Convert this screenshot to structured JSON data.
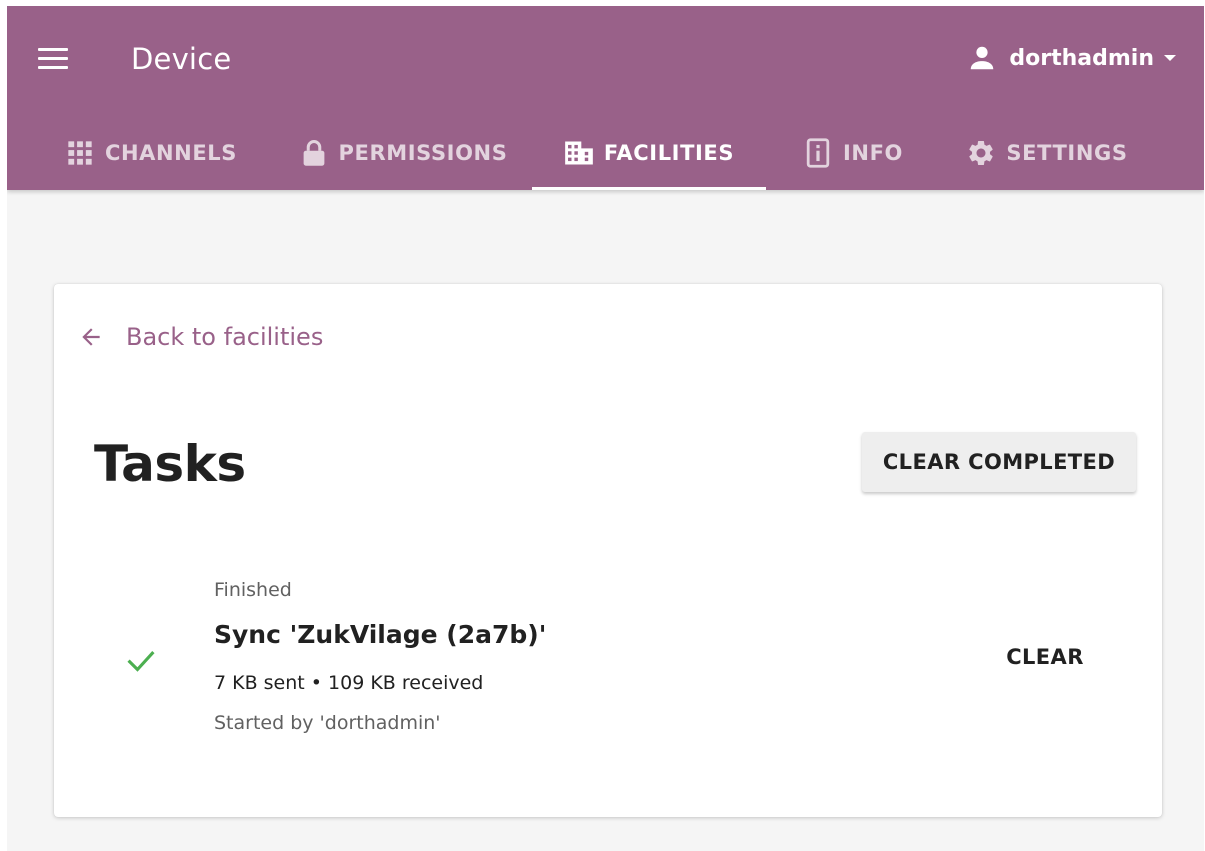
{
  "app": {
    "title": "Device",
    "menu_icon": "hamburger-menu-icon",
    "user": {
      "name": "dorthadmin",
      "icon": "person-icon",
      "caret_icon": "caret-down-icon"
    }
  },
  "tabs": [
    {
      "label": "CHANNELS",
      "icon": "grid-icon",
      "active": false
    },
    {
      "label": "PERMISSIONS",
      "icon": "lock-icon",
      "active": false
    },
    {
      "label": "FACILITIES",
      "icon": "building-icon",
      "active": true
    },
    {
      "label": "INFO",
      "icon": "info-icon",
      "active": false
    },
    {
      "label": "SETTINGS",
      "icon": "gear-icon",
      "active": false
    }
  ],
  "content": {
    "back_link": {
      "label": "Back to facilities",
      "icon": "arrow-back-icon"
    },
    "heading": "Tasks",
    "clear_completed_label": "CLEAR COMPLETED",
    "tasks": [
      {
        "status": "Finished",
        "status_icon": "check-icon",
        "name": "Sync 'ZukVilage (2a7b)'",
        "transfer": "7 KB sent • 109 KB received",
        "started_by": "Started by 'dorthadmin'",
        "action_label": "CLEAR"
      }
    ]
  },
  "colors": {
    "brand": "#996189",
    "background": "#f5f5f5",
    "success": "#4caf50"
  }
}
